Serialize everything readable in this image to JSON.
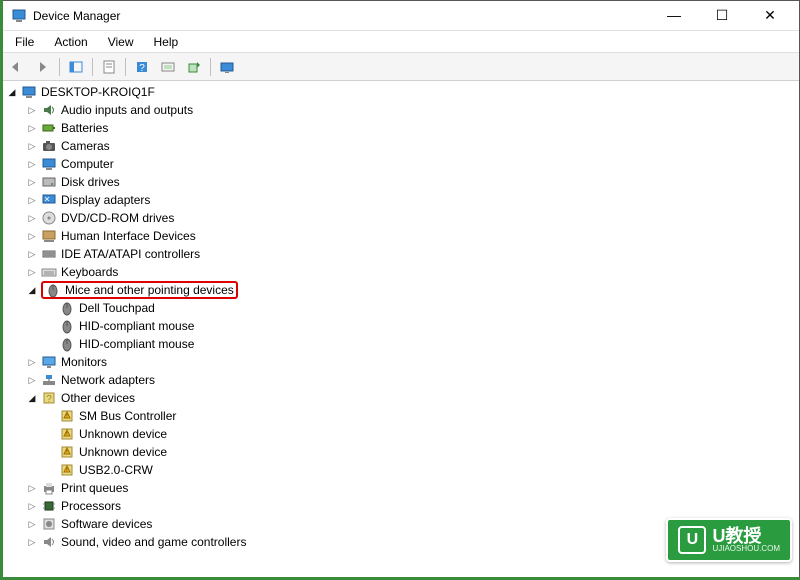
{
  "window": {
    "title": "Device Manager"
  },
  "window_controls": {
    "min": "—",
    "max": "☐",
    "close": "✕"
  },
  "menubar": [
    "File",
    "Action",
    "View",
    "Help"
  ],
  "root": {
    "label": "DESKTOP-KROIQ1F"
  },
  "categories": [
    {
      "icon": "audio",
      "label": "Audio inputs and outputs",
      "expanded": false
    },
    {
      "icon": "battery",
      "label": "Batteries",
      "expanded": false
    },
    {
      "icon": "camera",
      "label": "Cameras",
      "expanded": false
    },
    {
      "icon": "computer",
      "label": "Computer",
      "expanded": false
    },
    {
      "icon": "disk",
      "label": "Disk drives",
      "expanded": false
    },
    {
      "icon": "display",
      "label": "Display adapters",
      "expanded": false
    },
    {
      "icon": "dvd",
      "label": "DVD/CD-ROM drives",
      "expanded": false
    },
    {
      "icon": "hid",
      "label": "Human Interface Devices",
      "expanded": false
    },
    {
      "icon": "ide",
      "label": "IDE ATA/ATAPI controllers",
      "expanded": false
    },
    {
      "icon": "keyboard",
      "label": "Keyboards",
      "expanded": false
    },
    {
      "icon": "mouse",
      "label": "Mice and other pointing devices",
      "expanded": true,
      "highlighted": true,
      "children": [
        {
          "icon": "mouse",
          "label": "Dell Touchpad"
        },
        {
          "icon": "mouse",
          "label": "HID-compliant mouse"
        },
        {
          "icon": "mouse",
          "label": "HID-compliant mouse"
        }
      ]
    },
    {
      "icon": "monitor",
      "label": "Monitors",
      "expanded": false
    },
    {
      "icon": "network",
      "label": "Network adapters",
      "expanded": false
    },
    {
      "icon": "other",
      "label": "Other devices",
      "expanded": true,
      "children": [
        {
          "icon": "warn",
          "label": "SM Bus Controller"
        },
        {
          "icon": "warn",
          "label": "Unknown device"
        },
        {
          "icon": "warn",
          "label": "Unknown device"
        },
        {
          "icon": "warn",
          "label": "USB2.0-CRW"
        }
      ]
    },
    {
      "icon": "printer",
      "label": "Print queues",
      "expanded": false
    },
    {
      "icon": "cpu",
      "label": "Processors",
      "expanded": false
    },
    {
      "icon": "software",
      "label": "Software devices",
      "expanded": false
    },
    {
      "icon": "sound",
      "label": "Sound, video and game controllers",
      "expanded": false,
      "cut": true
    }
  ],
  "watermark": {
    "badge": "U",
    "main": "U教授",
    "sub": "UJIAOSHOU.COM"
  }
}
